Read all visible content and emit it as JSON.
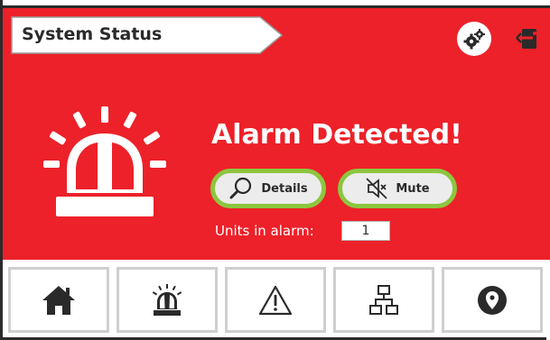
{
  "header": {
    "title": "System Status",
    "settings_icon": "gears-icon",
    "logout_icon": "logout-icon"
  },
  "alarm": {
    "headline": "Alarm Detected!",
    "icon": "alarm-beacon-icon",
    "details_label": "Details",
    "mute_label": "Mute",
    "units_label": "Units in alarm:",
    "units_value": "1"
  },
  "nav": {
    "items": [
      {
        "icon": "home-icon"
      },
      {
        "icon": "alarm-icon"
      },
      {
        "icon": "warning-icon"
      },
      {
        "icon": "network-icon"
      },
      {
        "icon": "location-icon"
      }
    ]
  },
  "colors": {
    "alarm_red": "#ed2129",
    "highlight_green": "#8cc63f",
    "dark": "#2a2a2a"
  }
}
